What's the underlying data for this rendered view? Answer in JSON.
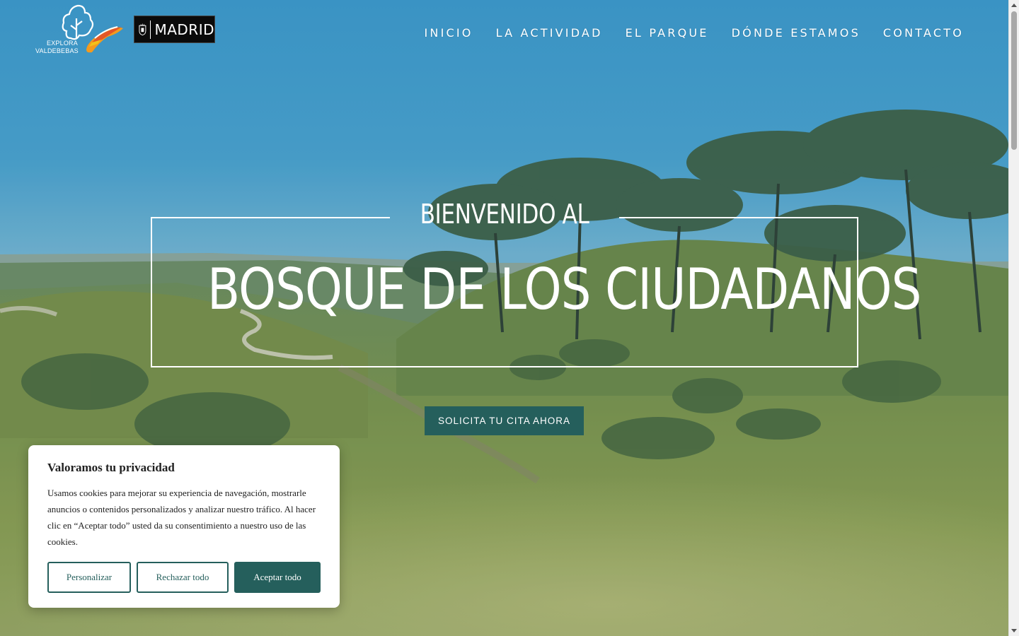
{
  "logos": {
    "explora_text_line1": "EXPLORA",
    "explora_text_line2": "VALDEBEBAS",
    "madrid_text": "MADRID"
  },
  "nav": {
    "items": [
      {
        "label": "INICIO"
      },
      {
        "label": "LA ACTIVIDAD"
      },
      {
        "label": "EL PARQUE"
      },
      {
        "label": "DÓNDE ESTAMOS"
      },
      {
        "label": "CONTACTO"
      }
    ]
  },
  "hero": {
    "subtitle": "BIENVENIDO AL",
    "title": "BOSQUE DE LOS CIUDADANOS",
    "cta_label": "SOLICITA TU CITA AHORA"
  },
  "cookie_banner": {
    "title": "Valoramos tu privacidad",
    "body": "Usamos cookies para mejorar su experiencia de navegación, mostrarle anuncios o contenidos personalizados y analizar nuestro tráfico. Al hacer clic en “Aceptar todo” usted da su consentimiento a nuestro uso de las cookies.",
    "customize_label": "Personalizar",
    "reject_label": "Rechazar todo",
    "accept_label": "Aceptar todo"
  },
  "colors": {
    "accent": "#255f5c",
    "sky_top": "#3f9ecf",
    "grass": "#8a9a4a"
  }
}
